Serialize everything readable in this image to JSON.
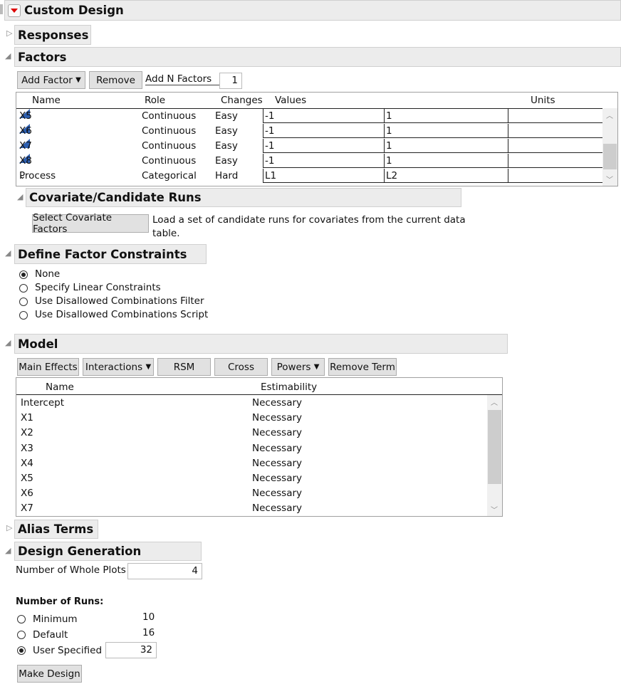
{
  "title": "Custom Design",
  "sections": {
    "responses": "Responses",
    "factors": "Factors",
    "covariate": "Covariate/Candidate Runs",
    "constraints": "Define Factor Constraints",
    "model": "Model",
    "alias": "Alias Terms",
    "generation": "Design Generation"
  },
  "factors": {
    "add_factor": "Add Factor",
    "remove": "Remove",
    "add_n_label": "Add N Factors",
    "add_n_value": "1",
    "columns": [
      "Name",
      "Role",
      "Changes",
      "Values",
      "Units"
    ],
    "rows": [
      {
        "name": "X5",
        "role": "Continuous",
        "changes": "Easy",
        "low": "-1",
        "high": "1",
        "icon": "continuous-icon"
      },
      {
        "name": "X6",
        "role": "Continuous",
        "changes": "Easy",
        "low": "-1",
        "high": "1",
        "icon": "continuous-icon"
      },
      {
        "name": "X7",
        "role": "Continuous",
        "changes": "Easy",
        "low": "-1",
        "high": "1",
        "icon": "continuous-icon"
      },
      {
        "name": "X8",
        "role": "Continuous",
        "changes": "Easy",
        "low": "-1",
        "high": "1",
        "icon": "continuous-icon"
      },
      {
        "name": "Process",
        "role": "Categorical",
        "changes": "Hard",
        "low": "L1",
        "high": "L2",
        "icon": "categorical-icon"
      }
    ]
  },
  "covariate": {
    "button": "Select Covariate Factors",
    "desc1": "Load a set of candidate runs for covariates from the current data",
    "desc2": "table."
  },
  "constraints": {
    "options": [
      "None",
      "Specify Linear Constraints",
      "Use Disallowed Combinations Filter",
      "Use Disallowed Combinations Script"
    ],
    "selected": 0
  },
  "model": {
    "buttons": [
      "Main Effects",
      "Interactions",
      "RSM",
      "Cross",
      "Powers",
      "Remove Term"
    ],
    "columns": [
      "Name",
      "Estimability"
    ],
    "rows": [
      [
        "Intercept",
        "Necessary"
      ],
      [
        "X1",
        "Necessary"
      ],
      [
        "X2",
        "Necessary"
      ],
      [
        "X3",
        "Necessary"
      ],
      [
        "X4",
        "Necessary"
      ],
      [
        "X5",
        "Necessary"
      ],
      [
        "X6",
        "Necessary"
      ],
      [
        "X7",
        "Necessary"
      ]
    ]
  },
  "generation": {
    "whole_plots_label": "Number of Whole Plots",
    "whole_plots": "4",
    "runs_label": "Number of Runs:",
    "runs": [
      {
        "label": "Minimum",
        "value": "10"
      },
      {
        "label": "Default",
        "value": "16"
      },
      {
        "label": "User Specified",
        "value": "32"
      }
    ],
    "selected": 2,
    "make_design": "Make Design"
  }
}
